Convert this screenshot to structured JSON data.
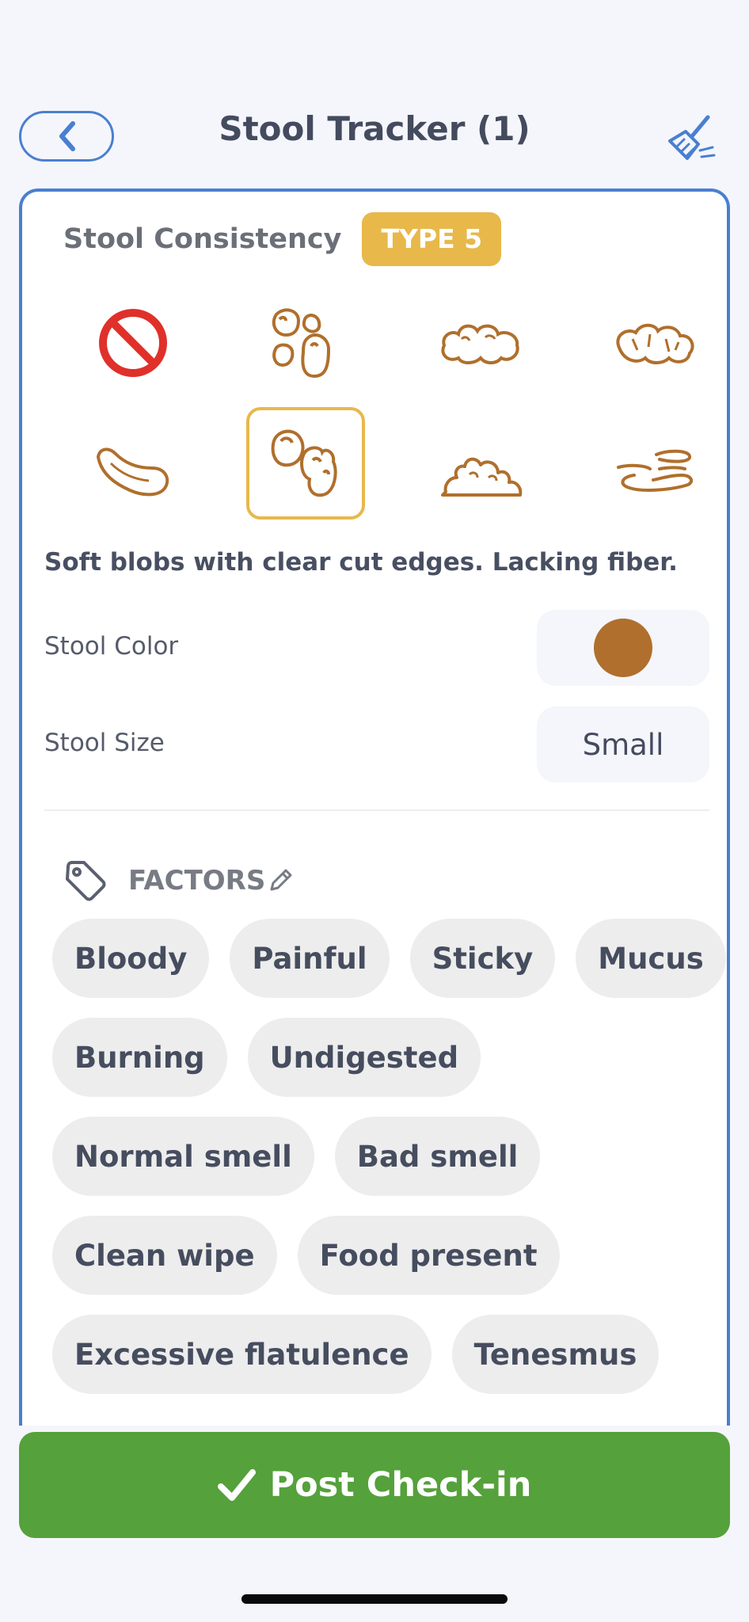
{
  "header": {
    "title": "Stool Tracker (1)"
  },
  "consistency": {
    "label": "Stool Consistency",
    "badge": "TYPE 5",
    "description": "Soft blobs with clear cut edges. Lacking fiber.",
    "types": [
      {
        "icon": "no-entry-icon",
        "selected": false
      },
      {
        "icon": "separate-hard-lumps-icon",
        "selected": false
      },
      {
        "icon": "lumpy-sausage-icon",
        "selected": false
      },
      {
        "icon": "cracked-sausage-icon",
        "selected": false
      },
      {
        "icon": "smooth-snake-icon",
        "selected": false
      },
      {
        "icon": "soft-blobs-icon",
        "selected": true
      },
      {
        "icon": "mushy-pieces-icon",
        "selected": false
      },
      {
        "icon": "watery-icon",
        "selected": false
      }
    ]
  },
  "properties": {
    "color_label": "Stool Color",
    "color_value": "#b06f2c",
    "size_label": "Stool Size",
    "size_value": "Small"
  },
  "factors": {
    "label": "FACTORS",
    "chips": [
      [
        "Bloody",
        "Painful",
        "Sticky",
        "Mucus"
      ],
      [
        "Burning",
        "Undigested"
      ],
      [
        "Normal smell",
        "Bad smell"
      ],
      [
        "Clean wipe",
        "Food present"
      ],
      [
        "Excessive flatulence",
        "Tenesmus"
      ]
    ]
  },
  "footer": {
    "post_label": "Post Check-in"
  },
  "colors": {
    "accent": "#4a7fd0",
    "badge": "#e8b84a",
    "icon_stroke": "#b06f2c",
    "post_button": "#55a13b"
  }
}
